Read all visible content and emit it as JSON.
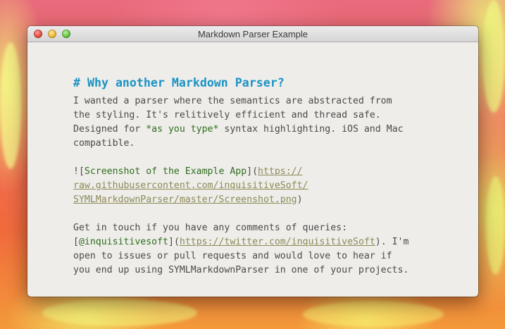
{
  "window": {
    "title": "Markdown Parser Example"
  },
  "editor": {
    "heading": "# Why another Markdown Parser?",
    "para1": {
      "line1": "I wanted a parser where the semantics are abstracted from",
      "line2": "the styling. It's relitively efficient and thread safe.",
      "line3_prefix": "Designed for ",
      "line3_emphasis": "*as you type*",
      "line3_suffix": " syntax highlighting. iOS and Mac",
      "line4": "compatible."
    },
    "image_link": {
      "open": "![",
      "alt": "Screenshot of the Example App",
      "mid": "](",
      "url_line1": "https://",
      "url_line2": "raw.githubusercontent.com/inquisitiveSoft/",
      "url_line3": "SYMLMarkdownParser/master/Screenshot.png",
      "close": ")"
    },
    "para2": {
      "line1": "Get in touch if you have any comments of queries:",
      "line2_open": "[",
      "line2_linktext": "@inquisitivesoft",
      "line2_mid": "](",
      "line2_url": "https://twitter.com/inquisitiveSoft",
      "line2_suffix": "). I'm",
      "line3": "open to issues or pull requests and would love to hear if",
      "line4": "you end up using SYMLMarkdownParser in one of your projects."
    }
  },
  "colors": {
    "heading": "#1a93c4",
    "emphasis": "#2f6e1c",
    "url": "#8c8a56",
    "body_text": "#4a4a48",
    "window_bg": "#eeedea"
  }
}
